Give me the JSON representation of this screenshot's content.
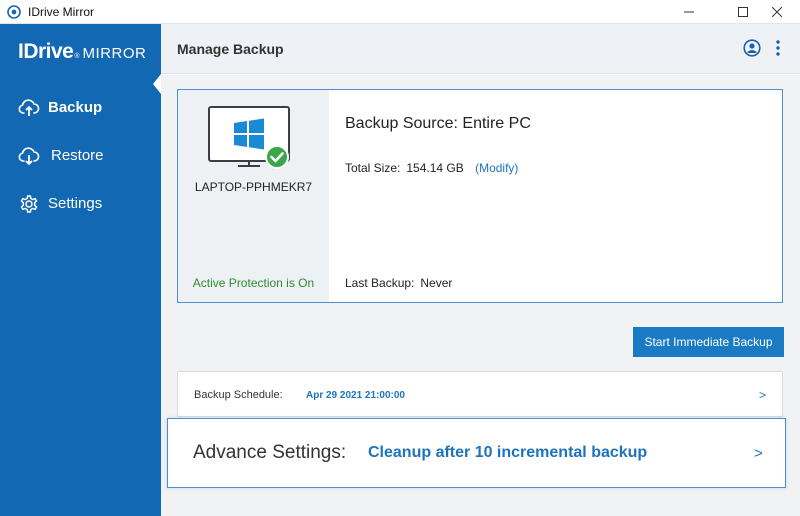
{
  "window": {
    "title": "IDrive Mirror",
    "controls": [
      "minimize-icon",
      "maximize-icon",
      "close-icon"
    ]
  },
  "sidebar": {
    "logo": {
      "brand": "IDrive",
      "reg": "®",
      "product": "MIRROR"
    },
    "items": [
      {
        "label": "Backup",
        "icon": "cloud-upload-icon",
        "active": true
      },
      {
        "label": "Restore",
        "icon": "cloud-download-icon",
        "active": false
      },
      {
        "label": "Settings",
        "icon": "gear-icon",
        "active": false
      }
    ]
  },
  "header": {
    "title": "Manage Backup",
    "icons": [
      "user-account-icon",
      "more-vertical-icon"
    ]
  },
  "device": {
    "name": "LAPTOP-PPHMEKR7",
    "protection_status": "Active Protection is On",
    "icon": "windows-monitor-icon",
    "check_icon": "check-circle-icon"
  },
  "backup": {
    "source_title": "Backup Source: Entire PC",
    "total_size_label": "Total Size:",
    "total_size_value": "154.14 GB",
    "modify_link": "(Modify)",
    "last_backup_label": "Last Backup:",
    "last_backup_value": "Never",
    "start_button": "Start Immediate Backup"
  },
  "schedule": {
    "label": "Backup Schedule:",
    "value": "Apr 29 2021 21:00:00",
    "arrow": ">"
  },
  "advance": {
    "label": "Advance Settings:",
    "value": "Cleanup after 10 incremental backup",
    "arrow": ">"
  },
  "colors": {
    "sidebar": "#1368b3",
    "accent": "#1e73be",
    "button": "#1a7bc4",
    "success": "#2e8b2e",
    "windows_blue": "#1a8ad4",
    "check_green": "#3aa84a"
  }
}
